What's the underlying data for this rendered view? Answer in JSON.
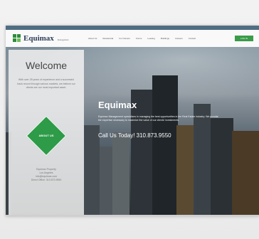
{
  "site": {
    "logo": {
      "name": "Equimax",
      "tagline": "Management"
    },
    "nav": [
      "About Us",
      "Residential",
      "For Owners",
      "Forms",
      "Leasing",
      "Buildings",
      "Careers",
      "Contact"
    ],
    "login_label": "LOG IN"
  },
  "welcome": {
    "title": "Welcome",
    "text": "With over 28 years of experience and a successful track record through various markets, we believe our clients are our most important asset.",
    "about_label": "ABOUT US",
    "contact": {
      "company": "Equimax Property",
      "address": "Los Angeles",
      "email": "info@equimax.com",
      "phone": "Direct Office: 310.873.9550"
    }
  },
  "hero": {
    "title": "Equimax",
    "text": "Equimax Management specializes in managing the best opportunities in the Real Estate industry. We provide the expertise necessary to maximize the value of our clients' investments.",
    "phone": "Call Us Today! 310.873.9550"
  },
  "colors": {
    "accent": "#2e9b48",
    "topbar": "#4f6e83",
    "logo_text": "#2c3e58"
  }
}
